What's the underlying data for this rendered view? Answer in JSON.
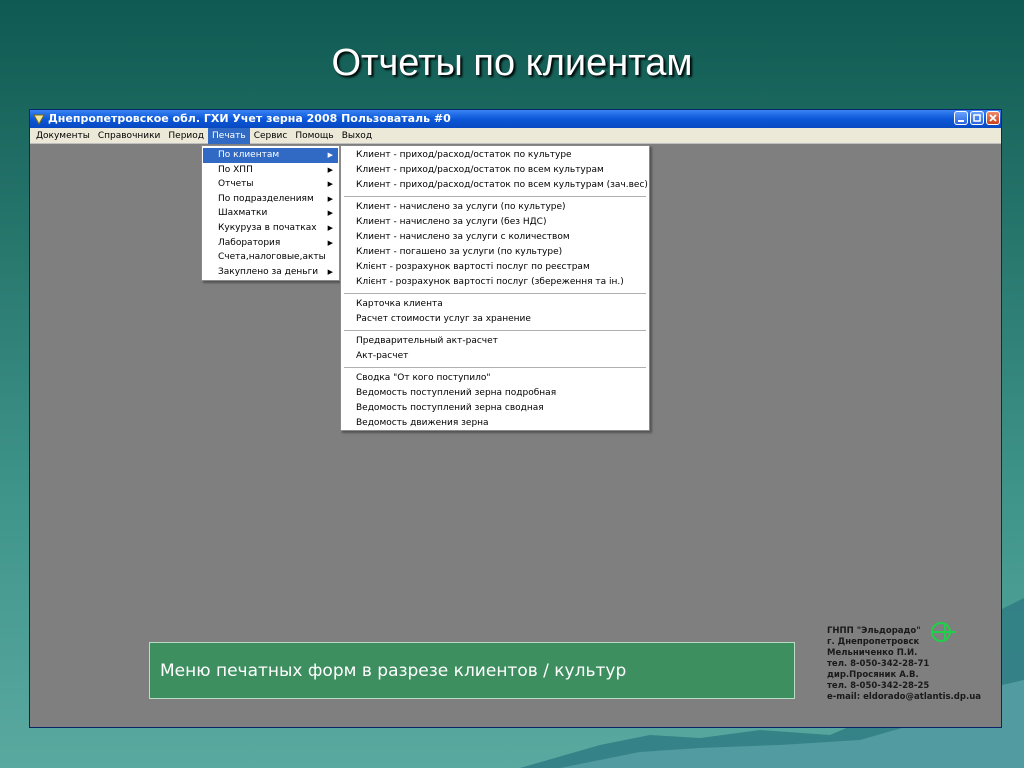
{
  "slide": {
    "title": "Отчеты по клиентам",
    "caption": "Меню печатных форм в разрезе клиентов / культур"
  },
  "window": {
    "title": "Днепропетровское  обл. ГХИ Учет зерна 2008 Пользоваталь #0",
    "icon": "grain-app-icon",
    "controls": [
      "minimize-icon",
      "maximize-icon",
      "close-icon"
    ]
  },
  "menubar": {
    "items": [
      {
        "label": "Документы"
      },
      {
        "label": "Справочники"
      },
      {
        "label": "Период"
      },
      {
        "label": "Печать",
        "active": true
      },
      {
        "label": "Сервис"
      },
      {
        "label": "Помощь"
      },
      {
        "label": "Выход"
      }
    ]
  },
  "print_menu": {
    "items": [
      {
        "label": "По клиентам",
        "submenu": true,
        "active": true
      },
      {
        "label": "По ХПП",
        "submenu": true
      },
      {
        "label": "Отчеты",
        "submenu": true
      },
      {
        "label": "По подразделениям",
        "submenu": true
      },
      {
        "label": "Шахматки",
        "submenu": true
      },
      {
        "label": "Кукуруза в початках",
        "submenu": true
      },
      {
        "label": "Лаборатория",
        "submenu": true
      },
      {
        "label": "Счета,налоговые,акты",
        "submenu": false
      },
      {
        "label": "Закуплено за деньги",
        "submenu": true
      }
    ]
  },
  "client_submenu": {
    "groups": [
      [
        "Клиент - приход/расход/остаток по культуре",
        "Клиент - приход/расход/остаток по всем культурам",
        "Клиент - приход/расход/остаток по всем культурам (зач.вес)"
      ],
      [
        "Клиент - начислено за услуги (по культуре)",
        "Клиент - начислено за услуги (без НДС)",
        "Клиент - начислено за услуги с количеством",
        "Клиент - погашено за услуги (по культуре)",
        "Клієнт - розрахунок вартості послуг по реєстрам",
        "Клієнт - розрахунок вартості послуг (збереження та ін.)"
      ],
      [
        "Карточка клиента",
        "Расчет стоимости услуг за хранение"
      ],
      [
        "Предварительный акт-расчет",
        "Акт-расчет"
      ],
      [
        "Сводка \"От кого поступило\"",
        "Ведомость поступлений зерна подробная",
        "Ведомость поступлений зерна сводная",
        "Ведомость движения зерна"
      ]
    ]
  },
  "credits": {
    "lines": [
      "ГНПП \"Эльдорадо\"",
      "г. Днепропетровск",
      "Мельниченко П.И.",
      "тел. 8-050-342-28-71",
      "дир.Просяник А.В.",
      "тел. 8-050-342-28-25",
      "e-mail: eldorado@atlantis.dp.ua"
    ],
    "logo": "eldorado-logo-icon"
  },
  "colors": {
    "titlebar": "#0b58d8",
    "menu_highlight": "#316ac5",
    "workspace": "#7f7f7f",
    "caption_bg": "#3e8f60"
  }
}
